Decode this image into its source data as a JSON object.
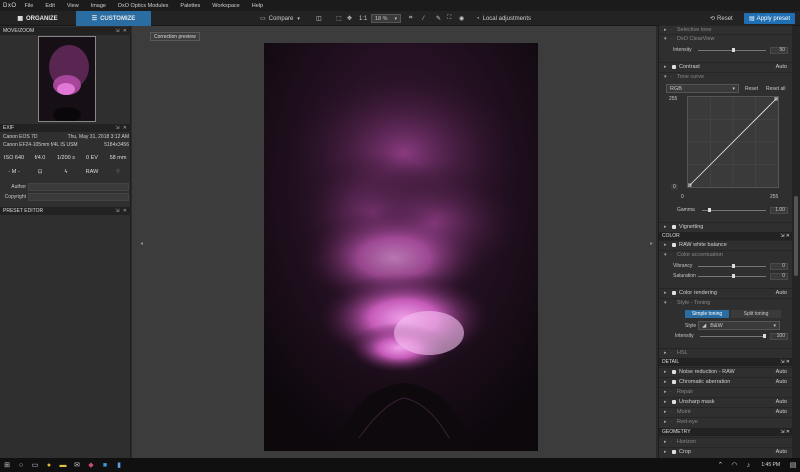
{
  "app": {
    "logo": "DxO"
  },
  "menu": [
    "File",
    "Edit",
    "View",
    "Image",
    "DxO Optics Modules",
    "Palettes",
    "Workspace",
    "Help"
  ],
  "toolbar": {
    "organize": "ORGANIZE",
    "customize": "CUSTOMIZE",
    "compare": "Compare",
    "ratio": "1:1",
    "zoom": "18 %",
    "local_adjustments": "Local adjustments",
    "reset": "Reset",
    "apply_preset": "Apply preset"
  },
  "tooltip": "Correction preview",
  "left": {
    "movezoom_title": "MOVE/ZOOM",
    "exif_title": "EXIF",
    "camera": "Canon EOS 7D",
    "date": "Thu, May 31, 2018 3:12 AM",
    "lens": "Canon EF24-105mm f/4L IS USM",
    "dims": "5184x3456",
    "iso": "ISO 640",
    "aperture": "f/4.0",
    "shutter": "1/200 s",
    "ev": "0 EV",
    "focal": "58 mm",
    "mode": "- M -",
    "raw": "RAW",
    "author_label": "Author",
    "copyright_label": "Copyright",
    "preset_title": "PRESET EDITOR"
  },
  "right": {
    "selective_tone": "Selective tone",
    "clearview": "DxO ClearView",
    "intensity_label": "Intensity",
    "intensity_value": "50",
    "contrast": "Contrast",
    "auto": "Auto",
    "tone_curve": "Tone curve",
    "channel": "RGB",
    "reset": "Reset",
    "reset_all": "Reset all",
    "curve_top": "255",
    "curve_left": "0",
    "curve_x0": "0",
    "curve_x255": "255",
    "gamma_label": "Gamma",
    "gamma_value": "1.00",
    "vignetting": "Vignetting",
    "color_section": "COLOR",
    "raw_wb": "RAW white balance",
    "color_accent": "Color accentuation",
    "vibrancy_label": "Vibrancy",
    "vibrancy_value": "0",
    "saturation_label": "Saturation",
    "saturation_value": "0",
    "color_rendering": "Color rendering",
    "style_toning": "Style - Toning",
    "simple_toning": "Simple toning",
    "split_toning": "Split toning",
    "style_label": "Style",
    "style_value": "B&W",
    "intensity2_value": "100",
    "hsl": "HSL",
    "detail_section": "DETAIL",
    "noise": "Noise reduction - RAW",
    "chromatic": "Chromatic aberration",
    "repair": "Repair",
    "unsharp": "Unsharp mask",
    "moire": "Moiré",
    "redeye": "Red-eye",
    "geometry_section": "GEOMETRY",
    "horizon": "Horizon",
    "crop": "Crop"
  },
  "taskbar": {
    "time": "1:45 PM"
  },
  "colors": {
    "accent": "#2a6da3",
    "smoke": "#c060b0"
  }
}
